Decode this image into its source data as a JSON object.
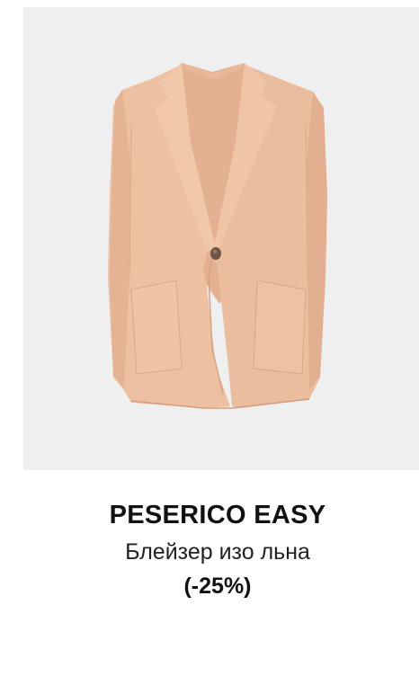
{
  "product": {
    "brand": "PESERICO EASY",
    "name": "Блейзер изо льна",
    "discount": "(-25%)",
    "image_icon": "blazer-image",
    "colors": {
      "background": "#efefef",
      "garment": "#ebbd9f"
    }
  }
}
